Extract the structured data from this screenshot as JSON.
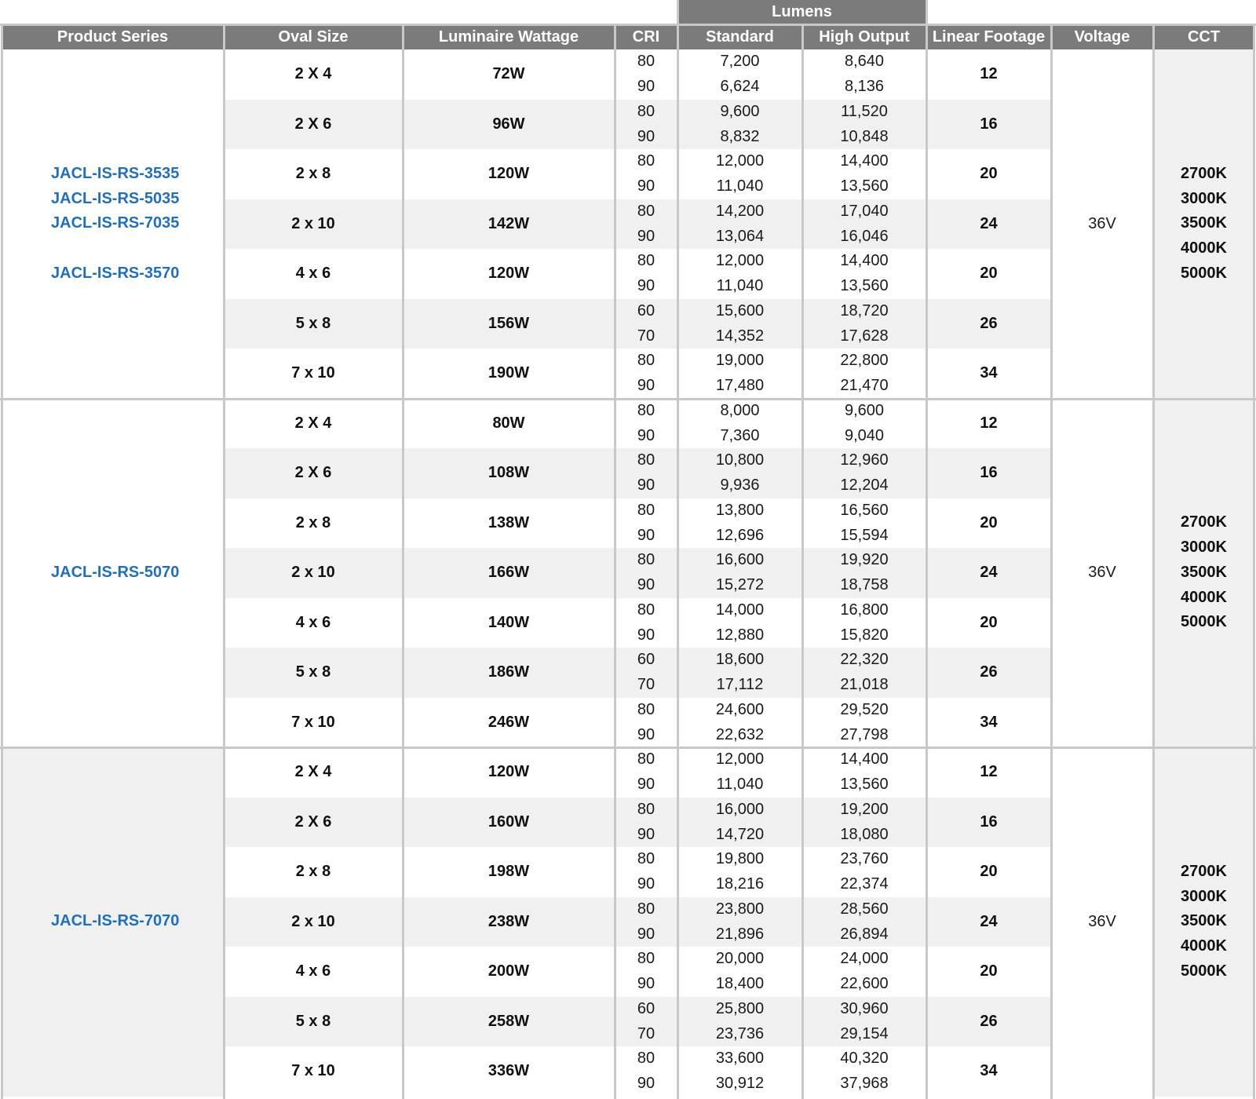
{
  "header": {
    "group_label": "Lumens",
    "columns": [
      "Product Series",
      "Oval Size",
      "Luminaire Wattage",
      "CRI",
      "Standard",
      "High Output",
      "Linear Footage",
      "Voltage",
      "CCT"
    ]
  },
  "colors": {
    "header_bg": "#7b7b7b",
    "series_text": "#1f6fbf",
    "band_gray": "#f0f0f0",
    "grid_line": "#c8c8c8"
  },
  "blocks": [
    {
      "series": [
        "JACL-IS-RS-3535",
        "JACL-IS-RS-5035",
        "JACL-IS-RS-7035",
        "",
        "JACL-IS-RS-3570"
      ],
      "voltage": "36V",
      "cct": [
        "2700K",
        "3000K",
        "3500K",
        "4000K",
        "5000K"
      ],
      "rows": [
        {
          "oval": "2 X 4",
          "watt": "72W",
          "cri": [
            "80",
            "90"
          ],
          "std": [
            "7,200",
            "6,624"
          ],
          "ho": [
            "8,640",
            "8,136"
          ],
          "ft": "12"
        },
        {
          "oval": "2 X 6",
          "watt": "96W",
          "cri": [
            "80",
            "90"
          ],
          "std": [
            "9,600",
            "8,832"
          ],
          "ho": [
            "11,520",
            "10,848"
          ],
          "ft": "16"
        },
        {
          "oval": "2 x 8",
          "watt": "120W",
          "cri": [
            "80",
            "90"
          ],
          "std": [
            "12,000",
            "11,040"
          ],
          "ho": [
            "14,400",
            "13,560"
          ],
          "ft": "20"
        },
        {
          "oval": "2 x 10",
          "watt": "142W",
          "cri": [
            "80",
            "90"
          ],
          "std": [
            "14,200",
            "13,064"
          ],
          "ho": [
            "17,040",
            "16,046"
          ],
          "ft": "24"
        },
        {
          "oval": "4 x 6",
          "watt": "120W",
          "cri": [
            "80",
            "90"
          ],
          "std": [
            "12,000",
            "11,040"
          ],
          "ho": [
            "14,400",
            "13,560"
          ],
          "ft": "20"
        },
        {
          "oval": "5 x 8",
          "watt": "156W",
          "cri": [
            "60",
            "70"
          ],
          "std": [
            "15,600",
            "14,352"
          ],
          "ho": [
            "18,720",
            "17,628"
          ],
          "ft": "26"
        },
        {
          "oval": "7 x 10",
          "watt": "190W",
          "cri": [
            "80",
            "90"
          ],
          "std": [
            "19,000",
            "17,480"
          ],
          "ho": [
            "22,800",
            "21,470"
          ],
          "ft": "34"
        }
      ]
    },
    {
      "series": [
        "JACL-IS-RS-5070"
      ],
      "voltage": "36V",
      "cct": [
        "2700K",
        "3000K",
        "3500K",
        "4000K",
        "5000K"
      ],
      "rows": [
        {
          "oval": "2 X 4",
          "watt": "80W",
          "cri": [
            "80",
            "90"
          ],
          "std": [
            "8,000",
            "7,360"
          ],
          "ho": [
            "9,600",
            "9,040"
          ],
          "ft": "12"
        },
        {
          "oval": "2 X 6",
          "watt": "108W",
          "cri": [
            "80",
            "90"
          ],
          "std": [
            "10,800",
            "9,936"
          ],
          "ho": [
            "12,960",
            "12,204"
          ],
          "ft": "16"
        },
        {
          "oval": "2 x 8",
          "watt": "138W",
          "cri": [
            "80",
            "90"
          ],
          "std": [
            "13,800",
            "12,696"
          ],
          "ho": [
            "16,560",
            "15,594"
          ],
          "ft": "20"
        },
        {
          "oval": "2 x 10",
          "watt": "166W",
          "cri": [
            "80",
            "90"
          ],
          "std": [
            "16,600",
            "15,272"
          ],
          "ho": [
            "19,920",
            "18,758"
          ],
          "ft": "24"
        },
        {
          "oval": "4 x 6",
          "watt": "140W",
          "cri": [
            "80",
            "90"
          ],
          "std": [
            "14,000",
            "12,880"
          ],
          "ho": [
            "16,800",
            "15,820"
          ],
          "ft": "20"
        },
        {
          "oval": "5 x 8",
          "watt": "186W",
          "cri": [
            "60",
            "70"
          ],
          "std": [
            "18,600",
            "17,112"
          ],
          "ho": [
            "22,320",
            "21,018"
          ],
          "ft": "26"
        },
        {
          "oval": "7 x 10",
          "watt": "246W",
          "cri": [
            "80",
            "90"
          ],
          "std": [
            "24,600",
            "22,632"
          ],
          "ho": [
            "29,520",
            "27,798"
          ],
          "ft": "34"
        }
      ]
    },
    {
      "series": [
        "JACL-IS-RS-7070"
      ],
      "voltage": "36V",
      "cct": [
        "2700K",
        "3000K",
        "3500K",
        "4000K",
        "5000K"
      ],
      "rows": [
        {
          "oval": "2 X 4",
          "watt": "120W",
          "cri": [
            "80",
            "90"
          ],
          "std": [
            "12,000",
            "11,040"
          ],
          "ho": [
            "14,400",
            "13,560"
          ],
          "ft": "12"
        },
        {
          "oval": "2 X 6",
          "watt": "160W",
          "cri": [
            "80",
            "90"
          ],
          "std": [
            "16,000",
            "14,720"
          ],
          "ho": [
            "19,200",
            "18,080"
          ],
          "ft": "16"
        },
        {
          "oval": "2 x 8",
          "watt": "198W",
          "cri": [
            "80",
            "90"
          ],
          "std": [
            "19,800",
            "18,216"
          ],
          "ho": [
            "23,760",
            "22,374"
          ],
          "ft": "20"
        },
        {
          "oval": "2 x 10",
          "watt": "238W",
          "cri": [
            "80",
            "90"
          ],
          "std": [
            "23,800",
            "21,896"
          ],
          "ho": [
            "28,560",
            "26,894"
          ],
          "ft": "24"
        },
        {
          "oval": "4 x 6",
          "watt": "200W",
          "cri": [
            "80",
            "90"
          ],
          "std": [
            "20,000",
            "18,400"
          ],
          "ho": [
            "24,000",
            "22,600"
          ],
          "ft": "20"
        },
        {
          "oval": "5 x 8",
          "watt": "258W",
          "cri": [
            "60",
            "70"
          ],
          "std": [
            "25,800",
            "23,736"
          ],
          "ho": [
            "30,960",
            "29,154"
          ],
          "ft": "26"
        },
        {
          "oval": "7 x 10",
          "watt": "336W",
          "cri": [
            "80",
            "90"
          ],
          "std": [
            "33,600",
            "30,912"
          ],
          "ho": [
            "40,320",
            "37,968"
          ],
          "ft": "34"
        }
      ]
    }
  ]
}
